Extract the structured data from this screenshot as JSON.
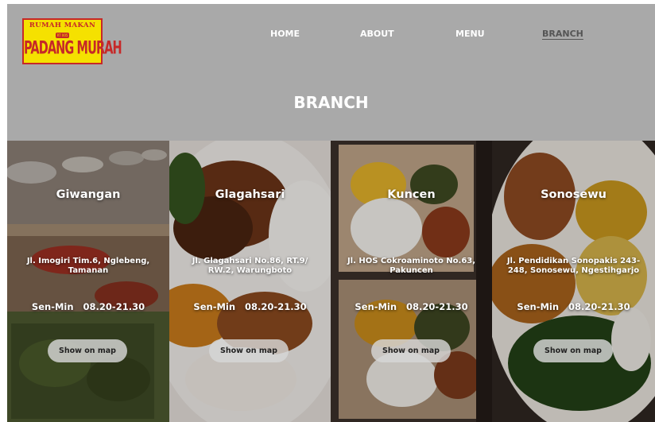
{
  "brand": {
    "logo_top": "RUMAH MAKAN",
    "logo_badge": "RT 005",
    "logo_main": "PADANG MURAH"
  },
  "nav": {
    "items": [
      {
        "label": "HOME"
      },
      {
        "label": "ABOUT"
      },
      {
        "label": "MENU"
      },
      {
        "label": "BRANCH",
        "active": true
      }
    ]
  },
  "page": {
    "title": "BRANCH"
  },
  "branches": [
    {
      "name": "Giwangan",
      "address": "Jl. Imogiri Tim.6, Nglebeng, Tamanan",
      "hours": "Sen-Min   08.20-21.30",
      "button": "Show on map"
    },
    {
      "name": "Glagahsari",
      "address": "Jl. Glagahsari No.86, RT.9/ RW.2, Warungboto",
      "hours": "Sen-Min   08.20-21.30",
      "button": "Show on map"
    },
    {
      "name": "Kuncen",
      "address": "Jl. HOS Cokroaminoto No.63, Pakuncen",
      "hours": "Sen-Min   08.20-21.30",
      "button": "Show on map"
    },
    {
      "name": "Sonosewu",
      "address": "Jl. Pendidikan Sonopakis 243-248, Sonosewu, Ngestihgarjo",
      "hours": "Sen-Min   08.20-21.30",
      "button": "Show on map"
    }
  ],
  "colors": {
    "header_bg": "#a9a9a9",
    "logo_yellow": "#f5e100",
    "logo_red": "#c62828",
    "nav_text": "#ffffff",
    "nav_active": "#555555"
  }
}
